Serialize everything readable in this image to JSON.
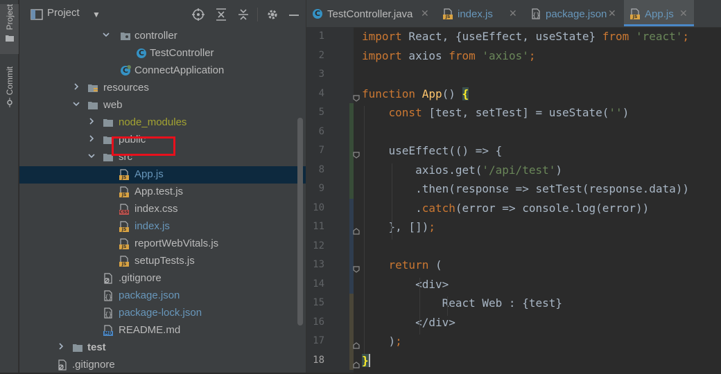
{
  "toolstrip": {
    "project_label": "Project",
    "commit_label": "Commit"
  },
  "panel": {
    "title": "Project",
    "icons": [
      "locate-icon",
      "expand-all-icon",
      "collapse-all-icon",
      "gear-icon",
      "minimize-icon"
    ]
  },
  "tree": [
    {
      "label": "controller",
      "kind": "package"
    },
    {
      "label": "TestController",
      "kind": "class"
    },
    {
      "label": "ConnectApplication",
      "kind": "springclass"
    },
    {
      "label": "resources",
      "kind": "folder-res"
    },
    {
      "label": "web",
      "kind": "folder"
    },
    {
      "label": "node_modules",
      "kind": "folder"
    },
    {
      "label": "public",
      "kind": "folder"
    },
    {
      "label": "src",
      "kind": "folder"
    },
    {
      "label": "App.js",
      "kind": "js"
    },
    {
      "label": "App.test.js",
      "kind": "js"
    },
    {
      "label": "index.css",
      "kind": "css"
    },
    {
      "label": "index.js",
      "kind": "js"
    },
    {
      "label": "reportWebVitals.js",
      "kind": "js"
    },
    {
      "label": "setupTests.js",
      "kind": "js"
    },
    {
      "label": ".gitignore",
      "kind": "gitignore"
    },
    {
      "label": "package.json",
      "kind": "json"
    },
    {
      "label": "package-lock.json",
      "kind": "json"
    },
    {
      "label": "README.md",
      "kind": "md"
    },
    {
      "label": "test",
      "kind": "folder"
    },
    {
      "label": ".gitignore",
      "kind": "gitignore"
    }
  ],
  "editor_tabs": [
    {
      "label": "TestController.java",
      "kind": "class"
    },
    {
      "label": "index.js",
      "kind": "js"
    },
    {
      "label": "package.json",
      "kind": "json"
    },
    {
      "label": "App.js",
      "kind": "js"
    }
  ],
  "line_numbers": [
    "1",
    "2",
    "3",
    "4",
    "5",
    "6",
    "7",
    "8",
    "9",
    "10",
    "11",
    "12",
    "13",
    "14",
    "15",
    "16",
    "17",
    "18"
  ],
  "code_lines": [
    "import React, {useEffect, useState} from 'react';",
    "import axios from 'axios';",
    "",
    "function App() {",
    "    const [test, setTest] = useState('')",
    "",
    "    useEffect(() => {",
    "        axios.get('/api/test')",
    "        .then(response => setTest(response.data))",
    "        .catch(error => console.log(error))",
    "    }, []);",
    "",
    "    return (",
    "        <div>",
    "            React Web : {test}",
    "        </div>",
    "    );",
    "}"
  ],
  "file_badges": {
    "js": "JS",
    "css": "CSS",
    "md": "MD",
    "class": "C"
  },
  "colors": {
    "selection": "#0d293e",
    "highlight_box": "#e8101c",
    "keyword": "#cc7832",
    "string": "#6a8759",
    "function": "#ffc66d"
  }
}
